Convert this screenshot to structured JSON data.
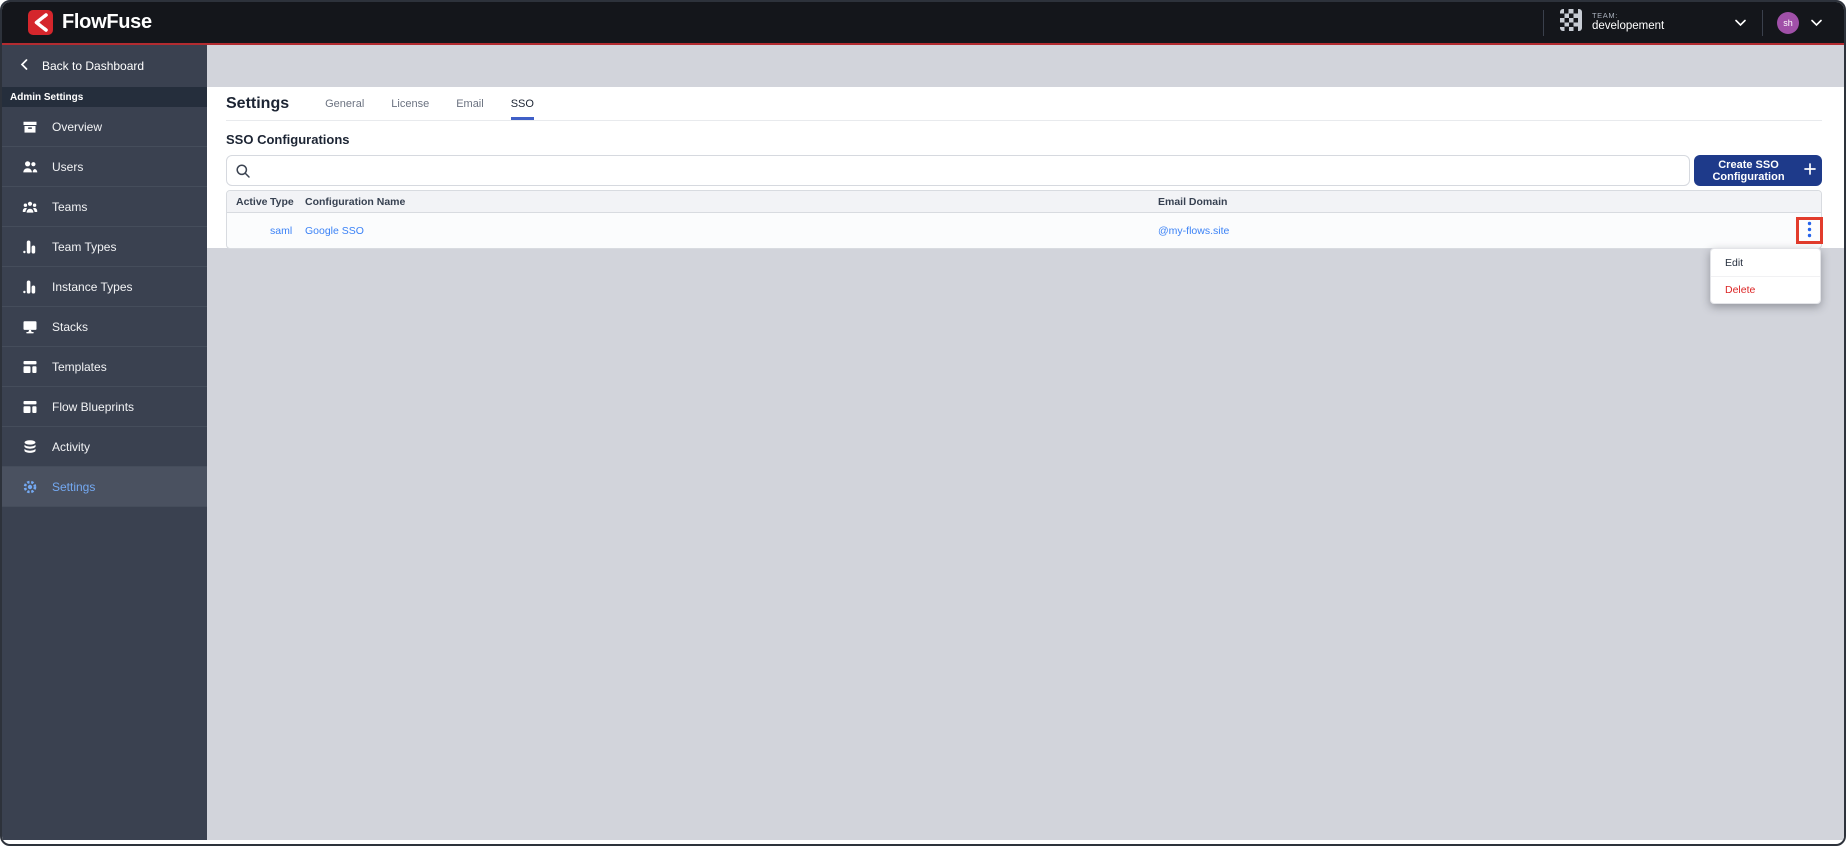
{
  "navbar": {
    "brand": "FlowFuse",
    "team_label": "TEAM:",
    "team_name": "developement",
    "avatar_initials": "sh"
  },
  "sidebar": {
    "back_label": "Back to Dashboard",
    "section_label": "Admin Settings",
    "items": [
      {
        "label": "Overview",
        "icon": "overview-icon",
        "active": false
      },
      {
        "label": "Users",
        "icon": "users-icon",
        "active": false
      },
      {
        "label": "Teams",
        "icon": "teams-icon",
        "active": false
      },
      {
        "label": "Team Types",
        "icon": "team-types-icon",
        "active": false
      },
      {
        "label": "Instance Types",
        "icon": "instance-types-icon",
        "active": false
      },
      {
        "label": "Stacks",
        "icon": "stacks-icon",
        "active": false
      },
      {
        "label": "Templates",
        "icon": "templates-icon",
        "active": false
      },
      {
        "label": "Flow Blueprints",
        "icon": "blueprints-icon",
        "active": false
      },
      {
        "label": "Activity",
        "icon": "activity-icon",
        "active": false
      },
      {
        "label": "Settings",
        "icon": "settings-gear-icon",
        "active": true
      }
    ]
  },
  "main": {
    "page_title": "Settings",
    "tabs": [
      {
        "label": "General",
        "active": false
      },
      {
        "label": "License",
        "active": false
      },
      {
        "label": "Email",
        "active": false
      },
      {
        "label": "SSO",
        "active": true
      }
    ],
    "section_title": "SSO Configurations",
    "search_value": "",
    "create_button_label": "Create SSO Configuration",
    "table": {
      "headers": [
        "Active",
        "Type",
        "Configuration Name",
        "Email Domain"
      ],
      "rows": [
        {
          "active": "",
          "type": "saml",
          "name": "Google SSO",
          "email_domain": "@my-flows.site"
        }
      ]
    },
    "row_menu": {
      "edit_label": "Edit",
      "delete_label": "Delete"
    }
  },
  "colors": {
    "brand_red": "#d5262c",
    "accent_line_red": "#b32b30",
    "link_blue": "#3b82f6",
    "active_nav_blue": "#74a9f2",
    "tab_underline_blue": "#3f5fc7",
    "button_navy": "#1e3a8a",
    "danger_red": "#dc2626",
    "highlight_box_red": "#e23c2c",
    "sidebar_bg": "#3a4150",
    "page_gray": "#d2d4db"
  }
}
